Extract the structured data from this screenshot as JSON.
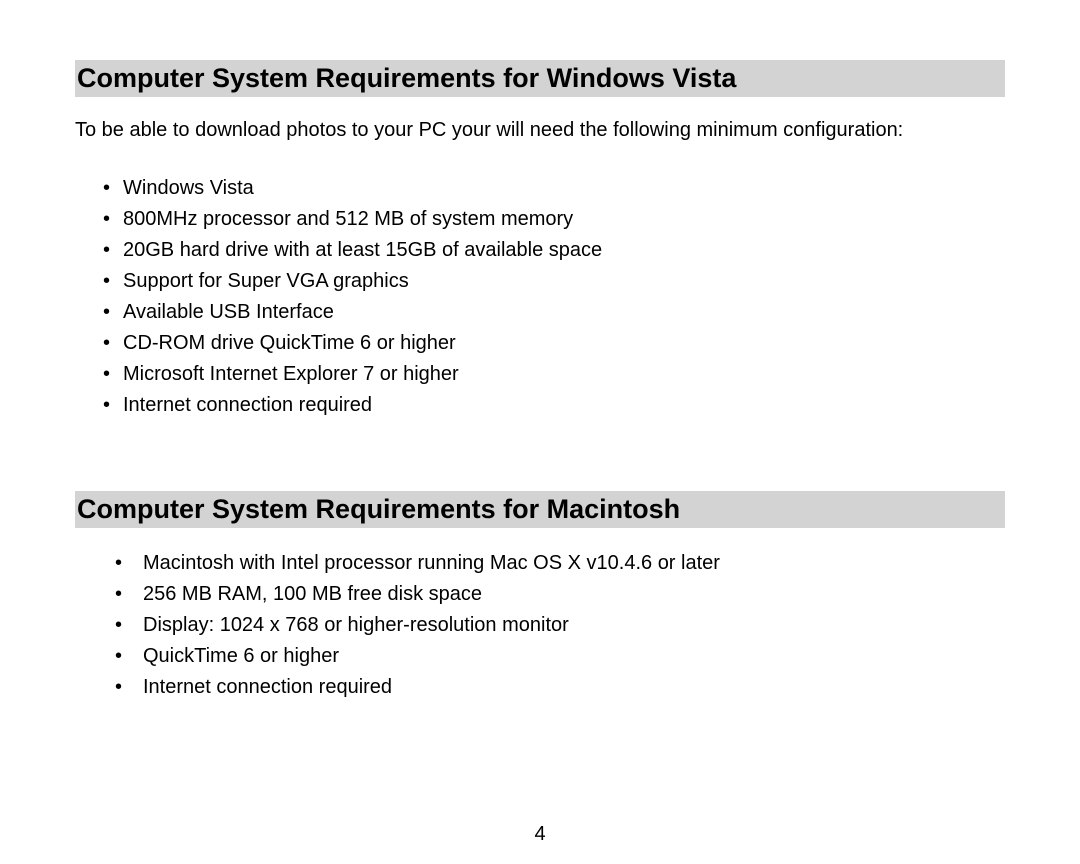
{
  "section1": {
    "heading": "Computer System Requirements for Windows Vista",
    "intro": "To be able to download photos to your PC your will need the following minimum configuration:",
    "items": [
      "Windows Vista",
      "800MHz processor and 512 MB of system memory",
      "20GB hard drive with at least 15GB of available space",
      "Support for Super VGA graphics",
      "Available USB Interface",
      "CD-ROM drive QuickTime 6 or higher",
      "Microsoft Internet Explorer 7 or higher",
      "Internet connection required"
    ]
  },
  "section2": {
    "heading": "Computer System Requirements for Macintosh",
    "items": [
      "Macintosh with Intel processor running Mac OS X v10.4.6 or later",
      "256 MB RAM, 100 MB free disk space",
      "Display: 1024 x 768 or higher-resolution monitor",
      "QuickTime 6 or higher",
      "Internet connection required"
    ]
  },
  "page_number": "4"
}
